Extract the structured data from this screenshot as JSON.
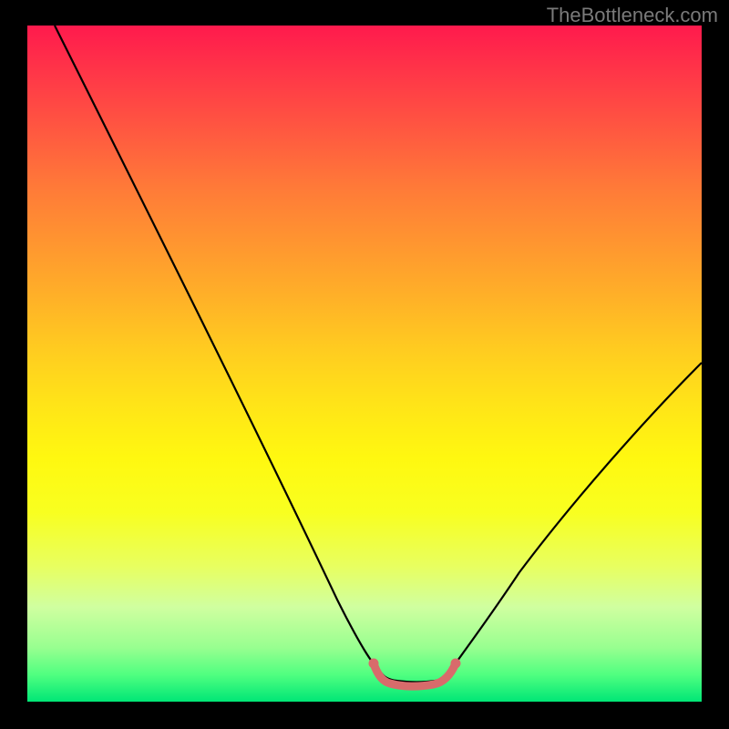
{
  "watermark": "TheBottleneck.com",
  "chart_data": {
    "type": "line",
    "title": "",
    "xlabel": "",
    "ylabel": "",
    "xlim": [
      0,
      100
    ],
    "ylim": [
      0,
      100
    ],
    "series": [
      {
        "name": "bottleneck-curve",
        "x": [
          0,
          8,
          16,
          24,
          32,
          40,
          48,
          50,
          52,
          54,
          56,
          58,
          60,
          62,
          64,
          72,
          80,
          88,
          96,
          100
        ],
        "values": [
          100,
          86,
          72,
          58,
          44,
          30,
          10,
          4,
          1,
          0.5,
          0.5,
          0.5,
          0.5,
          1,
          4,
          12,
          22,
          34,
          48,
          56
        ],
        "color": "#000000"
      },
      {
        "name": "optimal-range-marker",
        "x": [
          50,
          51,
          53,
          55,
          57,
          59,
          61,
          62
        ],
        "values": [
          3.5,
          1.5,
          0.8,
          0.8,
          0.8,
          0.8,
          1.5,
          3.5
        ],
        "color": "#d86b6b"
      }
    ],
    "background_gradient": {
      "stops": [
        {
          "pos": 0,
          "color": "#ff1a4d"
        },
        {
          "pos": 50,
          "color": "#ffe418"
        },
        {
          "pos": 100,
          "color": "#00e676"
        }
      ]
    }
  }
}
